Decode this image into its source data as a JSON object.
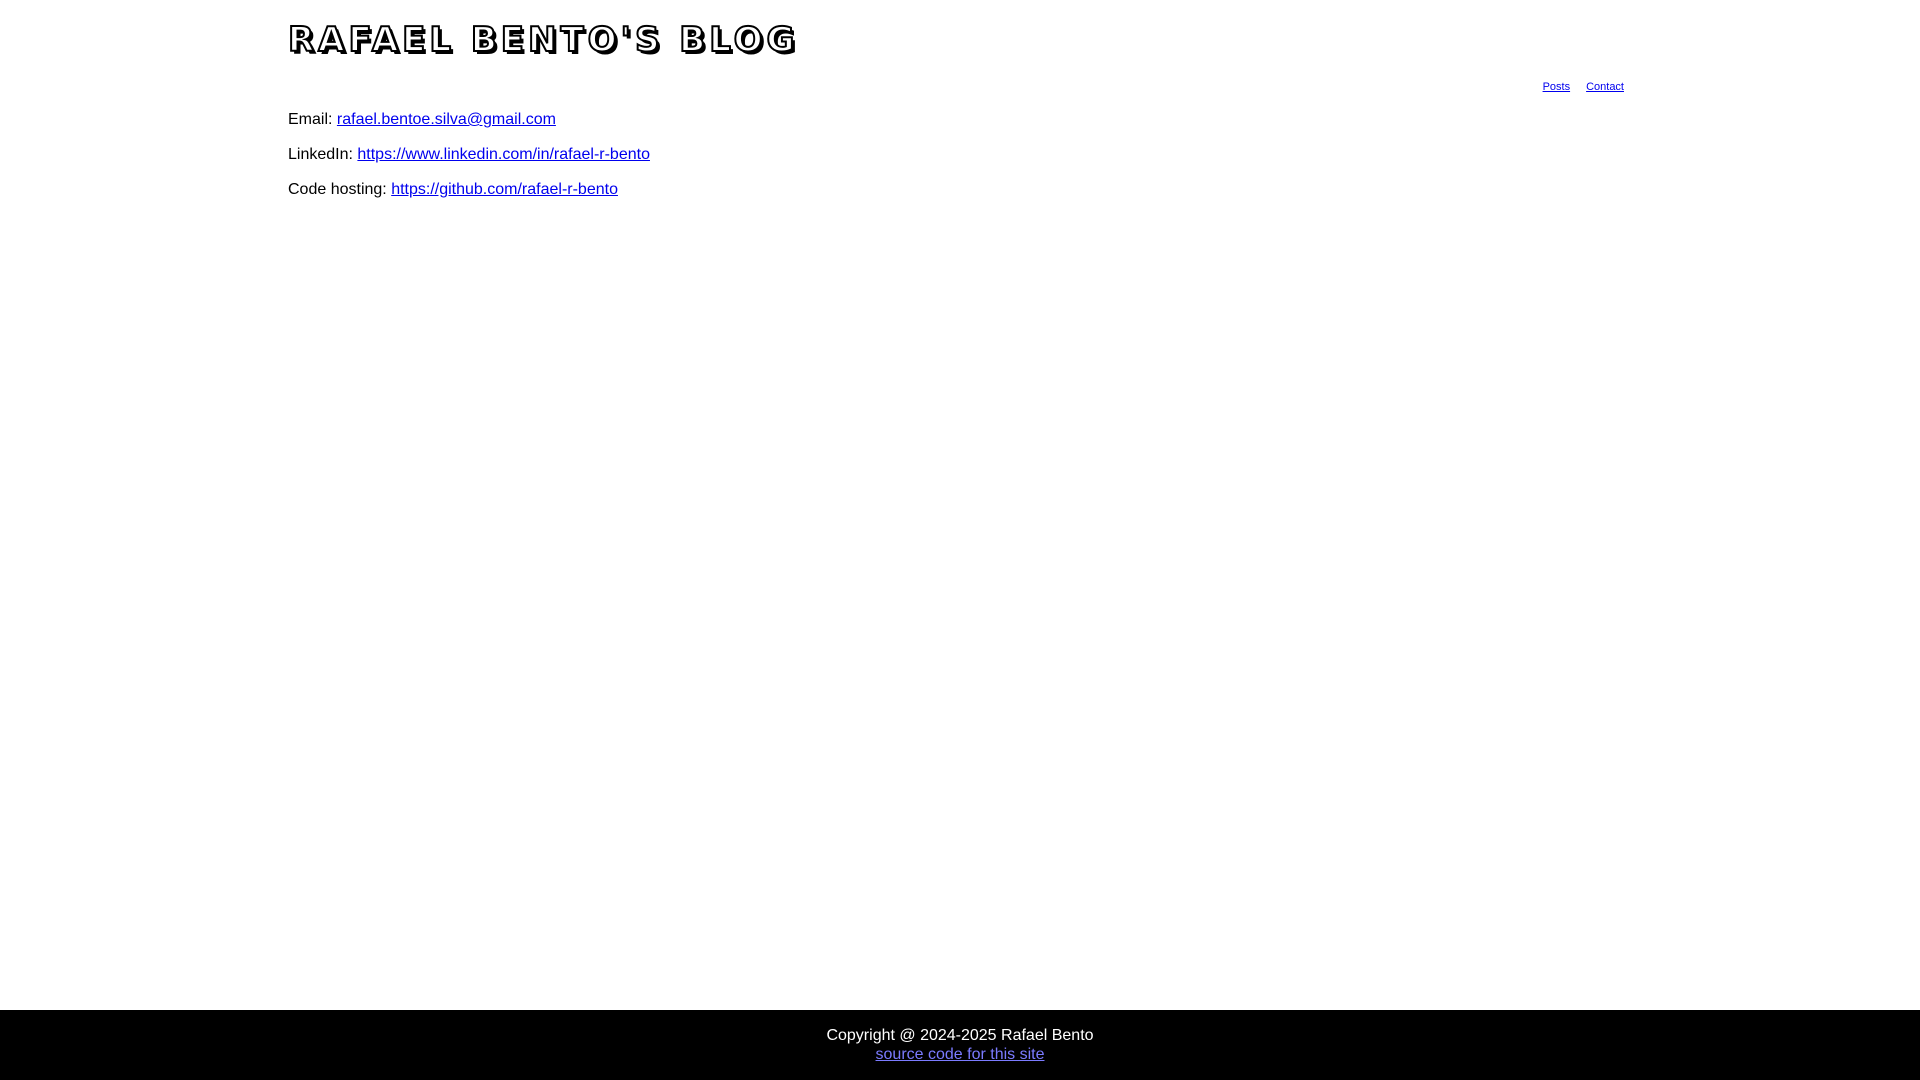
{
  "header": {
    "title": "Rafael Bento's blog"
  },
  "nav": {
    "items": [
      {
        "label": "Posts"
      },
      {
        "label": "Contact"
      }
    ]
  },
  "contact": {
    "email_label": "Email:",
    "email_link": "rafael.bentoe.silva@gmail.com",
    "linkedin_label": "LinkedIn:",
    "linkedin_link": "https://www.linkedin.com/in/rafael-r-bento",
    "code_label": "Code hosting:",
    "code_link": "https://github.com/rafael-r-bento"
  },
  "footer": {
    "copyright": "Copyright @ 2024-2025 Rafael Bento",
    "source_link": "source code for this site"
  },
  "colors": {
    "link": "#0000ee",
    "footer_link": "#7b7bff",
    "footer_bg": "#000000"
  }
}
